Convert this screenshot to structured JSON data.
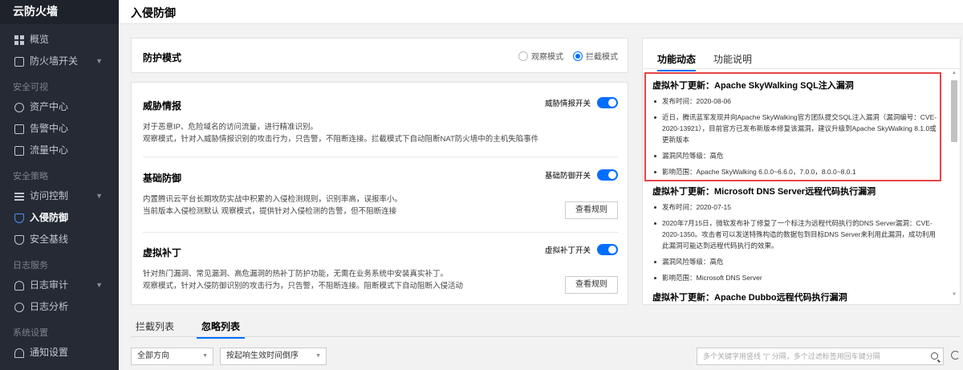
{
  "sidebar": {
    "brand": "云防火墙",
    "items": [
      {
        "label": "概览",
        "icon": "grid-icon",
        "type": "item"
      },
      {
        "label": "防火墙开关",
        "icon": "firewall-icon",
        "type": "item",
        "arrow": true
      },
      {
        "label": "安全可视",
        "type": "group"
      },
      {
        "label": "资产中心",
        "icon": "asset-icon",
        "type": "item"
      },
      {
        "label": "告警中心",
        "icon": "alarm-icon",
        "type": "item"
      },
      {
        "label": "流量中心",
        "icon": "traffic-icon",
        "type": "item"
      },
      {
        "label": "安全策略",
        "type": "group"
      },
      {
        "label": "访问控制",
        "icon": "access-icon",
        "type": "item",
        "arrow": true
      },
      {
        "label": "入侵防御",
        "icon": "shield-icon",
        "type": "item",
        "active": true
      },
      {
        "label": "安全基线",
        "icon": "baseline-icon",
        "type": "item"
      },
      {
        "label": "日志服务",
        "type": "group"
      },
      {
        "label": "日志审计",
        "icon": "audit-icon",
        "type": "item",
        "arrow": true
      },
      {
        "label": "日志分析",
        "icon": "analysis-icon",
        "type": "item"
      },
      {
        "label": "系统设置",
        "type": "group"
      },
      {
        "label": "通知设置",
        "icon": "bell-icon",
        "type": "item"
      }
    ]
  },
  "header": {
    "title": "入侵防御"
  },
  "mode": {
    "title": "防护模式",
    "options": [
      {
        "label": "观察模式",
        "checked": false
      },
      {
        "label": "拦截模式",
        "checked": true
      }
    ]
  },
  "sections": [
    {
      "title": "威胁情报",
      "toggle_label": "威胁情报开关",
      "enabled": true,
      "desc": [
        "对于恶意IP、危险域名的访问流量，进行精准识别。",
        "观察模式，针对入威胁情报识别的攻击行为，只告警，不阻断连接。拦截模式下自动阻断NAT防火墙中的主机失陷事件"
      ]
    },
    {
      "title": "基础防御",
      "toggle_label": "基础防御开关",
      "enabled": true,
      "desc": [
        "内置腾讯云平台长期攻防实战中积累的入侵检测规则，识别率高，误报率小。",
        "当前版本入侵检测默认 观察模式，提供针对入侵检测的告警，但不阻断连接"
      ],
      "button": "查看规则"
    },
    {
      "title": "虚拟补丁",
      "toggle_label": "虚拟补丁开关",
      "enabled": true,
      "desc": [
        "针对热门漏洞、常见漏洞、高危漏洞的热补丁防护功能，无需在业务系统中安装真实补丁。",
        "观察模式，针对入侵防御识别的攻击行为，只告警，不阻断连接。阻断模式下自动阻断入侵活动"
      ],
      "button": "查看规则"
    }
  ],
  "right_panel": {
    "tabs": [
      {
        "label": "功能动态",
        "active": true
      },
      {
        "label": "功能说明",
        "active": false
      }
    ],
    "feed": [
      {
        "title": "虚拟补丁更新：Apache SkyWalking SQL注入漏洞",
        "items": [
          "发布时间：2020-08-06",
          "近日，腾讯蓝军发现并向Apache SkyWalking官方团队提交SQL注入漏洞（漏洞编号：CVE-2020-13921），目前官方已发布新版本修复该漏洞，建议升级到Apache SkyWalking 8.1.0或更新版本",
          "漏洞风险等级：高危",
          "影响范围：Apache SkyWalking 6.0.0~6.6.0，7.0.0，8.0.0~8.0.1"
        ]
      },
      {
        "title": "虚拟补丁更新：Microsoft DNS Server远程代码执行漏洞",
        "items": [
          "发布时间：2020-07-15",
          "2020年7月15日，微软发布补丁修复了一个标注为远程代码执行的DNS Server漏洞：CVE-2020-1350。攻击者可以发送特殊构造的数据包到目标DNS Server来利用此漏洞，成功利用此漏洞可能达到远程代码执行的效果。",
          "漏洞风险等级：高危",
          "影响范围：Microsoft DNS Server"
        ]
      },
      {
        "title": "虚拟补丁更新：Apache Dubbo远程代码执行漏洞",
        "items": []
      }
    ]
  },
  "bottom": {
    "tabs": [
      {
        "label": "拦截列表",
        "active": false
      },
      {
        "label": "忽略列表",
        "active": true
      }
    ],
    "direction_select": "全部方向",
    "sort_select": "按起响生效时间倒序",
    "search_placeholder": "多个关键字用竖线 \"|\" 分隔，多个过滤标签用回车键分隔"
  },
  "colors": {
    "accent": "#006eff",
    "highlight_border": "#e54545",
    "sidebar_bg": "#252a35"
  }
}
